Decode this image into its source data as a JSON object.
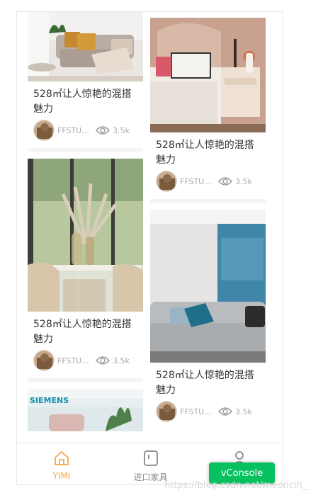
{
  "feed": {
    "left": [
      {
        "title": "528㎡让人惊艳的混搭魅力",
        "author": "FFSTU...",
        "views": "3.5k",
        "image": "living-room-sofa"
      },
      {
        "title": "528㎡让人惊艳的混搭魅力",
        "author": "FFSTU...",
        "views": "3.5k",
        "image": "dining-room-pampas"
      },
      {
        "title": "",
        "author": "",
        "views": "",
        "image": "siemens-showroom"
      }
    ],
    "right": [
      {
        "title": "528㎡让人惊艳的混搭魅力",
        "author": "FFSTU...",
        "views": "3.5k",
        "image": "bedroom-nightstand"
      },
      {
        "title": "528㎡让人惊艳的混搭魅力",
        "author": "FFSTU...",
        "views": "3.5k",
        "image": "grey-sofa-blue-art"
      }
    ]
  },
  "siemens_text": "SIEMENS",
  "tabbar": {
    "items": [
      {
        "label": "YIMI",
        "icon": "home-icon",
        "active": true
      },
      {
        "label": "进口家具",
        "icon": "furniture-icon",
        "active": false
      },
      {
        "label": "",
        "icon": "user-icon",
        "active": false
      }
    ]
  },
  "vconsole": {
    "label": "vConsole"
  },
  "watermark": "https://blog.csdn.net/meoncih_",
  "colors": {
    "active_tab": "#f3a84a",
    "vconsole": "#07c160",
    "text": "#333333",
    "muted": "#aaaaaa"
  }
}
